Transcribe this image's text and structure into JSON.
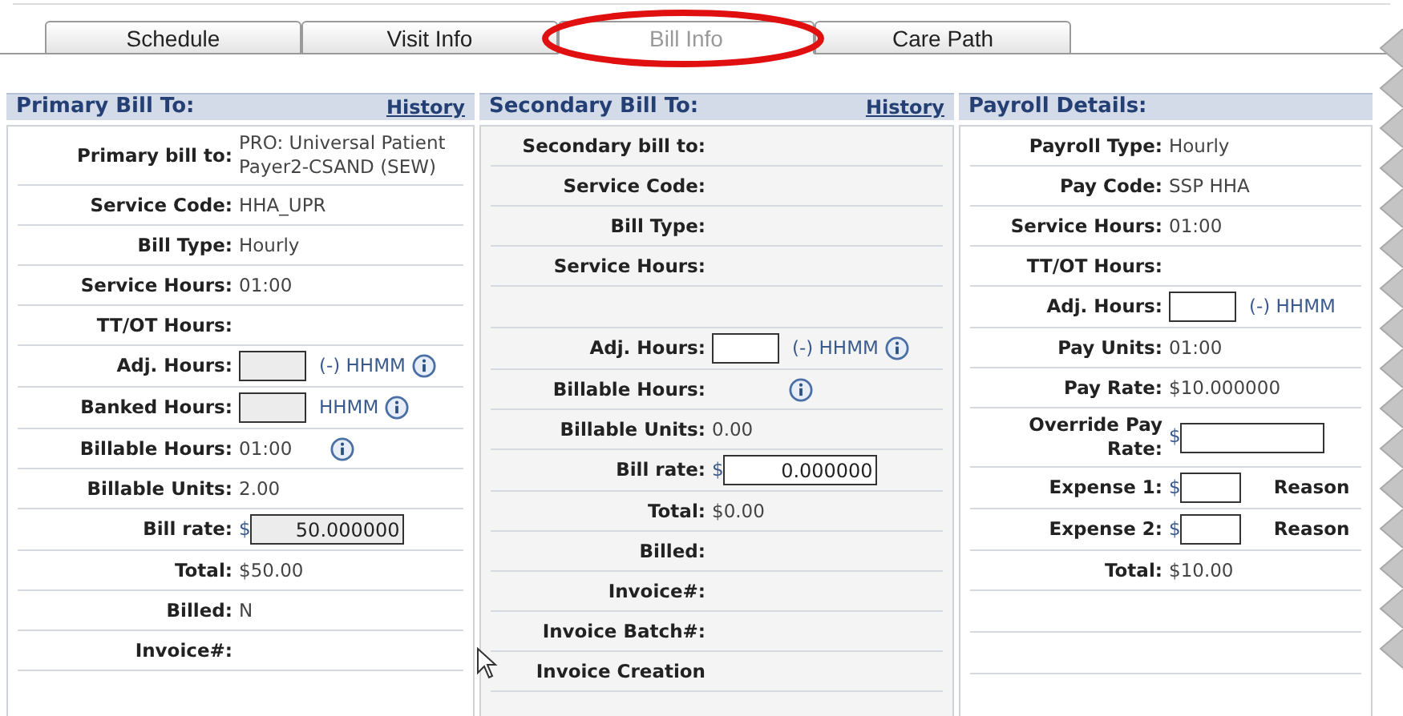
{
  "tabs": [
    {
      "label": "Schedule",
      "selected": false
    },
    {
      "label": "Visit Info",
      "selected": false
    },
    {
      "label": "Bill Info",
      "selected": true
    },
    {
      "label": "Care Path",
      "selected": false
    }
  ],
  "panels": [
    {
      "title": "Primary Bill To:",
      "link": "History",
      "rows": [
        {
          "kind": "text",
          "label": "Primary bill to:",
          "value": "PRO: Universal Patient Payer2-CSAND (SEW)"
        },
        {
          "kind": "text",
          "label": "Service Code:",
          "value": "HHA_UPR"
        },
        {
          "kind": "text",
          "label": "Bill Type:",
          "value": "Hourly"
        },
        {
          "kind": "text",
          "label": "Service Hours:",
          "value": "01:00"
        },
        {
          "kind": "text",
          "label": "TT/OT Hours:"
        },
        {
          "kind": "input",
          "label": "Adj. Hours:",
          "disabled": true,
          "suffix": "(-) HHMM",
          "info": true
        },
        {
          "kind": "input",
          "label": "Banked Hours:",
          "disabled": true,
          "suffix": "HHMM",
          "info": true
        },
        {
          "kind": "text",
          "label": "Billable Hours:",
          "value": "01:00",
          "info": true
        },
        {
          "kind": "text",
          "label": "Billable Units:",
          "value": "2.00"
        },
        {
          "kind": "rate",
          "label": "Bill rate:",
          "currency": "$",
          "value": "50.000000",
          "disabled": true
        },
        {
          "kind": "text",
          "label": "Total:",
          "value": "$50.00"
        },
        {
          "kind": "text",
          "label": "Billed:",
          "value": "N"
        },
        {
          "kind": "text",
          "label": "Invoice#:"
        }
      ]
    },
    {
      "title": "Secondary Bill To:",
      "link": "History",
      "rows": [
        {
          "kind": "text",
          "label": "Secondary bill to:"
        },
        {
          "kind": "text",
          "label": "Service Code:"
        },
        {
          "kind": "text",
          "label": "Bill Type:"
        },
        {
          "kind": "text",
          "label": "Service Hours:"
        },
        {
          "kind": "blank"
        },
        {
          "kind": "input",
          "label": "Adj. Hours:",
          "disabled": false,
          "suffix": "(-) HHMM",
          "info": true
        },
        {
          "kind": "text",
          "label": "Billable Hours:",
          "info": true
        },
        {
          "kind": "text",
          "label": "Billable Units:",
          "value": "0.00"
        },
        {
          "kind": "rate",
          "label": "Bill rate:",
          "currency": "$",
          "value": "0.000000",
          "disabled": false
        },
        {
          "kind": "text",
          "label": "Total:",
          "value": "$0.00"
        },
        {
          "kind": "text",
          "label": "Billed:"
        },
        {
          "kind": "text",
          "label": "Invoice#:"
        },
        {
          "kind": "text",
          "label": "Invoice Batch#:"
        },
        {
          "kind": "text",
          "label": "Invoice Creation"
        }
      ]
    },
    {
      "title": "Payroll Details:",
      "rows": [
        {
          "kind": "text",
          "label": "Payroll Type:",
          "value": "Hourly"
        },
        {
          "kind": "text",
          "label": "Pay Code:",
          "value": "SSP HHA"
        },
        {
          "kind": "text",
          "label": "Service Hours:",
          "value": "01:00"
        },
        {
          "kind": "text",
          "label": "TT/OT Hours:"
        },
        {
          "kind": "input",
          "label": "Adj. Hours:",
          "disabled": false,
          "suffix": "(-) HHMM"
        },
        {
          "kind": "text",
          "label": "Pay Units:",
          "value": "01:00"
        },
        {
          "kind": "text",
          "label": "Pay Rate:",
          "value": "$10.000000"
        },
        {
          "kind": "rate",
          "label": "Override Pay Rate:",
          "currency": "$",
          "disabled": false,
          "wide": true
        },
        {
          "kind": "rate",
          "label": "Expense 1:",
          "currency": "$",
          "disabled": false,
          "extra": "Reason"
        },
        {
          "kind": "rate",
          "label": "Expense 2:",
          "currency": "$",
          "disabled": false,
          "extra": "Reason"
        },
        {
          "kind": "text",
          "label": "Total:",
          "value": "$10.00"
        },
        {
          "kind": "blank"
        },
        {
          "kind": "blank"
        }
      ]
    }
  ]
}
